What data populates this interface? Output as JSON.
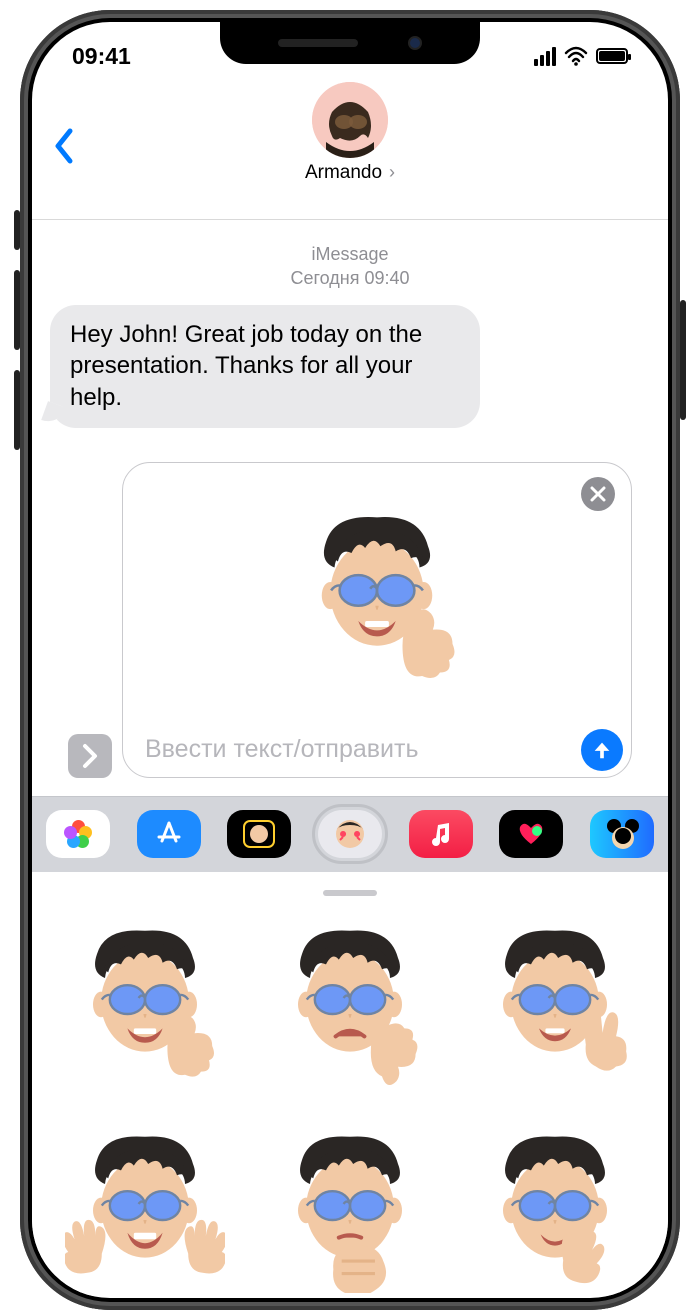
{
  "status": {
    "time": "09:41"
  },
  "header": {
    "contact_name": "Armando"
  },
  "conversation": {
    "service": "iMessage",
    "timestamp": "Сегодня 09:40",
    "incoming_text": "Hey John! Great job today on the presentation. Thanks for all your help."
  },
  "compose": {
    "placeholder": "Ввести текст/отправить",
    "staged_sticker": "memoji-thumbs-up"
  },
  "app_strip": {
    "items": [
      {
        "name": "photos-app"
      },
      {
        "name": "app-store-app"
      },
      {
        "name": "animoji-app"
      },
      {
        "name": "memoji-stickers-app",
        "selected": true
      },
      {
        "name": "apple-music-app"
      },
      {
        "name": "fitness-app"
      },
      {
        "name": "disney-app"
      }
    ]
  },
  "sticker_drawer": {
    "stickers": [
      "memoji-thumbs-up",
      "memoji-thumbs-down",
      "memoji-peace",
      "memoji-jazz-hands",
      "memoji-fist",
      "memoji-shush"
    ]
  }
}
